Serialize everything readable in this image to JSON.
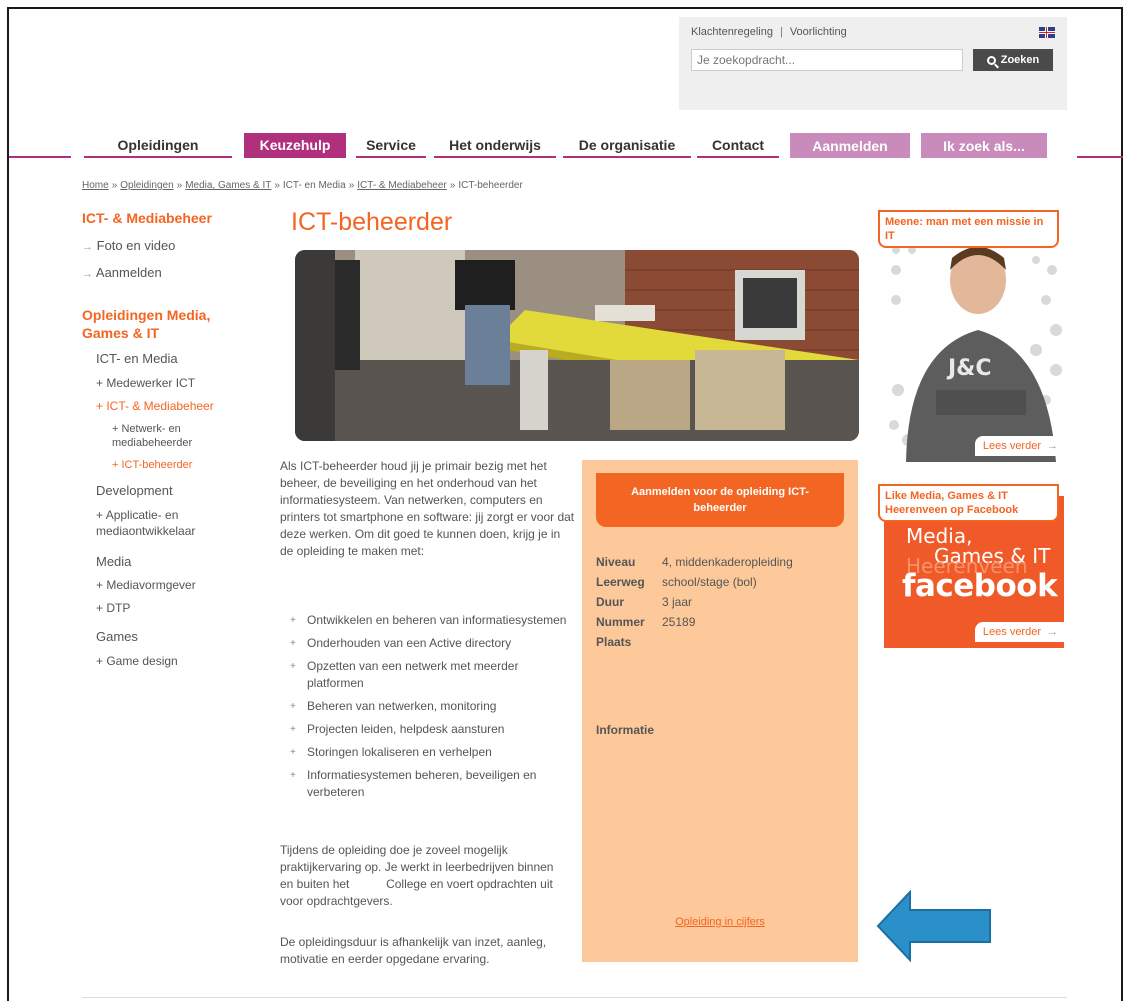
{
  "utility": {
    "links": [
      "Klachtenregeling",
      "Voorlichting"
    ],
    "separator": "|",
    "search_placeholder": "Je zoekopdracht...",
    "search_button": "Zoeken"
  },
  "nav": {
    "items": [
      "Opleidingen",
      "Keuzehulp",
      "Service",
      "Het onderwijs",
      "De organisatie",
      "Contact"
    ],
    "active": "Keuzehulp",
    "pills": [
      "Aanmelden",
      "Ik zoek als..."
    ],
    "accent": "#b0307e",
    "pill_color": "#c98bbb"
  },
  "breadcrumb": {
    "items": [
      "Home",
      "Opleidingen",
      "Media, Games & IT",
      "ICT- en Media",
      "ICT- & Mediabeheer",
      "ICT-beheerder"
    ],
    "separator": "»"
  },
  "sidebar": {
    "heading1": "ICT- & Mediabeheer",
    "top_items": [
      "Foto en video",
      "Aanmelden"
    ],
    "heading2": "Opleidingen Media, Games & IT",
    "groups": [
      {
        "label": "ICT- en Media",
        "items": [
          "Medewerker ICT",
          "ICT- & Mediabeheer"
        ],
        "subitems": [
          "Netwerk- en mediabeheerder",
          "ICT-beheerder"
        ]
      },
      {
        "label": "Development",
        "items": [
          "Applicatie- en mediaontwikkelaar"
        ]
      },
      {
        "label": "Media",
        "items": [
          "Mediavormgever",
          "DTP"
        ]
      },
      {
        "label": "Games",
        "items": [
          "Game design"
        ]
      }
    ]
  },
  "main": {
    "title": "ICT-beheerder",
    "intro": "Als ICT-beheerder houd jij je primair bezig met het beheer, de beveiliging en het onderhoud van het informatiesysteem. Van netwerken, computers en printers tot smartphone en software: jij zorgt er voor dat deze werken. Om dit goed te kunnen doen, krijg je in de opleiding te maken met:",
    "bullets": [
      "Ontwikkelen en beheren van informatiesystemen",
      "Onderhouden van een Active directory",
      "Opzetten van een netwerk met meerder platformen",
      "Beheren van netwerken, monitoring",
      "Projecten leiden, helpdesk aansturen",
      "Storingen lokaliseren en verhelpen",
      "Informatiesystemen beheren, beveiligen en verbeteren"
    ],
    "outro1": "Tijdens de opleiding doe je zoveel mogelijk praktijkervaring op. Je werkt in leerbedrijven binnen en buiten het           College en voert opdrachten uit voor opdrachtgevers.",
    "outro2": "De opleidingsduur is afhankelijk van inzet, aanleg, motivatie en eerder opgedane ervaring."
  },
  "infobox": {
    "apply_button": "Aanmelden voor de opleiding ICT-beheerder",
    "rows": [
      {
        "key": "Niveau",
        "value": "4, middenkaderopleiding"
      },
      {
        "key": "Leerweg",
        "value": "school/stage (bol)"
      },
      {
        "key": "Duur",
        "value": "3 jaar"
      },
      {
        "key": "Nummer",
        "value": "25189"
      },
      {
        "key": "Plaats",
        "value": ""
      }
    ],
    "info_label": "Informatie",
    "cijfers_link": "Opleiding in cijfers",
    "bg": "#fdc99a",
    "accent": "#f26522"
  },
  "promos": [
    {
      "tag": "Meene: man met een missie in IT",
      "more": "Lees verder"
    },
    {
      "tag": "Like Media, Games & IT Heerenveen op Facebook",
      "more": "Lees verder",
      "fb_line1": "Media,",
      "fb_line2": "Games & IT",
      "fb_ghost": "Heerenveen",
      "fb_word": "facebook"
    }
  ],
  "annotation_arrow_color": "#2b8fc9"
}
